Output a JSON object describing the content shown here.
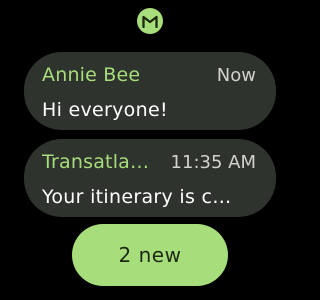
{
  "app": {
    "icon": "gmail-m-icon",
    "accent_color": "#a8dd7b",
    "card_color": "#2f332e"
  },
  "notifications": [
    {
      "sender": "Annie Bee",
      "time": "Now",
      "message": "Hi everyone!"
    },
    {
      "sender": "Transatla…",
      "time": "11:35 AM",
      "message": "Your itinerary is c…"
    }
  ],
  "new_button": {
    "label": "2 new"
  }
}
